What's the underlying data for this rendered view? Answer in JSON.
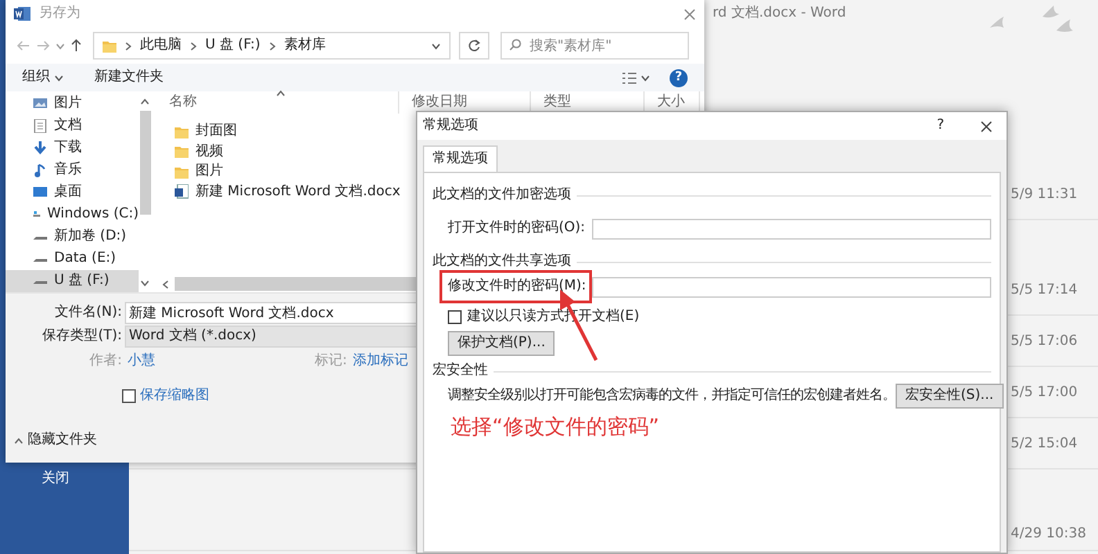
{
  "word_window": {
    "title": "rd 文档.docx - Word",
    "sidebar": {
      "items": [
        {
          "label": "关闭"
        }
      ]
    },
    "recent_times": [
      "5/9 11:31",
      "5/5 17:14",
      "5/5 17:06",
      "5/5 17:00",
      "5/2 15:04",
      "4/29 10:38"
    ]
  },
  "save_dialog": {
    "title": "另存为",
    "breadcrumb": [
      "此电脑",
      "U 盘 (F:)",
      "素材库"
    ],
    "search": {
      "placeholder": "搜索\"素材库\""
    },
    "toolbar": {
      "organize": "组织",
      "new_folder": "新建文件夹",
      "help": "?"
    },
    "nav_items": [
      {
        "label": "图片",
        "kind": "pictures",
        "selected": false
      },
      {
        "label": "文档",
        "kind": "documents",
        "selected": false
      },
      {
        "label": "下载",
        "kind": "downloads",
        "selected": false
      },
      {
        "label": "音乐",
        "kind": "music",
        "selected": false
      },
      {
        "label": "桌面",
        "kind": "desktop",
        "selected": false
      },
      {
        "label": "Windows (C:)",
        "kind": "system-drive",
        "selected": false
      },
      {
        "label": "新加卷 (D:)",
        "kind": "drive",
        "selected": false
      },
      {
        "label": "Data (E:)",
        "kind": "drive",
        "selected": false
      },
      {
        "label": "U 盘 (F:)",
        "kind": "drive",
        "selected": true
      }
    ],
    "columns": [
      "名称",
      "修改日期",
      "类型",
      "大小"
    ],
    "files": [
      {
        "name": "封面图",
        "kind": "folder"
      },
      {
        "name": "视频",
        "kind": "folder"
      },
      {
        "name": "图片",
        "kind": "folder"
      },
      {
        "name": "新建 Microsoft Word 文档.docx",
        "kind": "word-doc"
      }
    ],
    "file_name": {
      "label": "文件名(N):",
      "value": "新建 Microsoft Word 文档.docx"
    },
    "save_type": {
      "label": "保存类型(T):",
      "value": "Word 文档 (*.docx)"
    },
    "author": {
      "label": "作者:",
      "value": "小慧"
    },
    "tags": {
      "label": "标记:",
      "value": "添加标记"
    },
    "save_thumbnail": {
      "label": "保存缩略图",
      "checked": false
    },
    "hide_folders": "隐藏文件夹"
  },
  "options_dialog": {
    "title": "常规选项",
    "help": "?",
    "tabs": [
      {
        "label": "常规选项",
        "selected": true
      }
    ],
    "encryption": {
      "heading": "此文档的文件加密选项",
      "password_label": "打开文件时的密码(O):"
    },
    "sharing": {
      "heading": "此文档的文件共享选项",
      "password_label": "修改文件时的密码(M):",
      "read_only": {
        "label": "建议以只读方式打开文档(E)",
        "checked": false
      },
      "protect_button": "保护文档(P)..."
    },
    "macro": {
      "heading": "宏安全性",
      "description": "调整安全级别以打开可能包含宏病毒的文件，并指定可信任的宏创建者姓名。",
      "button": "宏安全性(S)..."
    }
  },
  "annotation": {
    "text": "选择“修改文件的密码”"
  }
}
